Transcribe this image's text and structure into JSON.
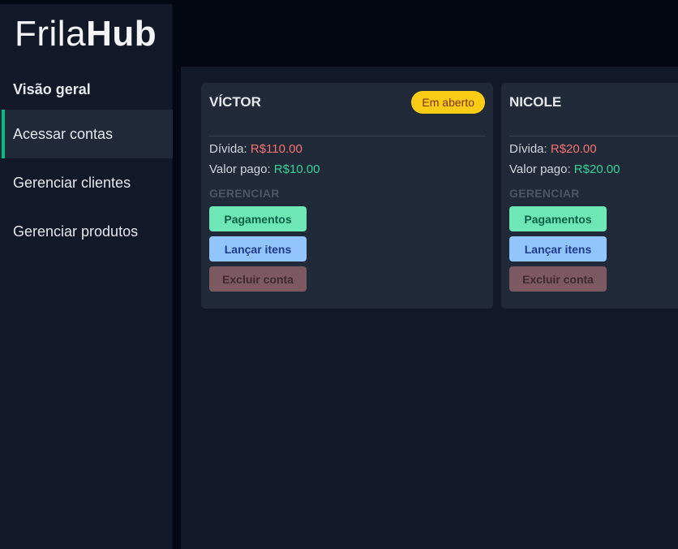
{
  "app": {
    "logo_light": "Frila",
    "logo_bold": "Hub"
  },
  "sidebar": {
    "title": "Visão geral",
    "items": [
      {
        "label": "Acessar contas",
        "active": true
      },
      {
        "label": "Gerenciar clientes",
        "active": false
      },
      {
        "label": "Gerenciar produtos",
        "active": false
      }
    ]
  },
  "accounts": [
    {
      "name": "VÍCTOR",
      "status": "Em aberto",
      "debt_label": "Dívida:",
      "debt_value": "R$110.00",
      "paid_label": "Valor pago:",
      "paid_value": "R$10.00",
      "manage_label": "GERENCIAR",
      "buttons": {
        "payments": "Pagamentos",
        "add_items": "Lançar itens",
        "delete": "Excluir conta"
      }
    },
    {
      "name": "NICOLE",
      "status": "",
      "debt_label": "Dívida:",
      "debt_value": "R$20.00",
      "paid_label": "Valor pago:",
      "paid_value": "R$20.00",
      "manage_label": "GERENCIAR",
      "buttons": {
        "payments": "Pagamentos",
        "add_items": "Lançar itens",
        "delete": "Excluir conta"
      }
    }
  ],
  "colors": {
    "accent": "#10b981",
    "debt": "#f87171",
    "paid": "#34d399",
    "badge": "#facc15"
  }
}
